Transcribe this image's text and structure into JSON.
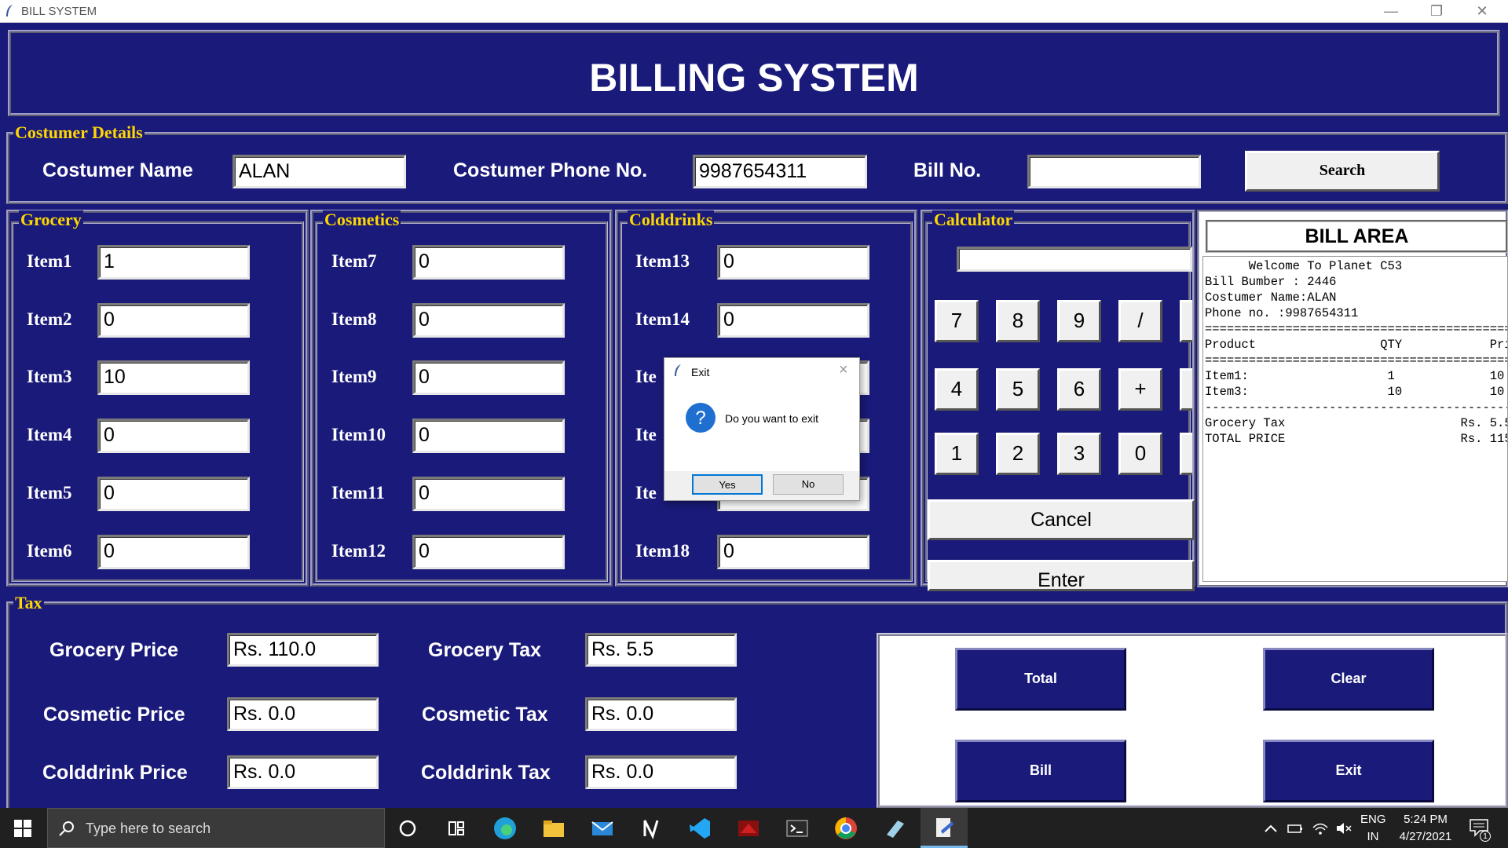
{
  "window": {
    "title": "BILL SYSTEM",
    "minimize": "—",
    "restore": "❐",
    "close": "✕"
  },
  "header": {
    "title": "BILLING SYSTEM"
  },
  "customer": {
    "section_label": "Costumer Details",
    "name_label": "Costumer Name",
    "name_value": "ALAN",
    "phone_label": "Costumer Phone No.",
    "phone_value": "9987654311",
    "bill_label": "Bill No.",
    "bill_value": "",
    "search_label": "Search"
  },
  "grocery": {
    "label": "Grocery",
    "items": [
      {
        "label": "Item1",
        "value": "1"
      },
      {
        "label": "Item2",
        "value": "0"
      },
      {
        "label": "Item3",
        "value": "10"
      },
      {
        "label": "Item4",
        "value": "0"
      },
      {
        "label": "Item5",
        "value": "0"
      },
      {
        "label": "Item6",
        "value": "0"
      }
    ]
  },
  "cosmetics": {
    "label": "Cosmetics",
    "items": [
      {
        "label": "Item7",
        "value": "0"
      },
      {
        "label": "Item8",
        "value": "0"
      },
      {
        "label": "Item9",
        "value": "0"
      },
      {
        "label": "Item10",
        "value": "0"
      },
      {
        "label": "Item11",
        "value": "0"
      },
      {
        "label": "Item12",
        "value": "0"
      }
    ]
  },
  "colddrinks": {
    "label": "Colddrinks",
    "items": [
      {
        "label": "Item13",
        "value": "0"
      },
      {
        "label": "Item14",
        "value": "0"
      },
      {
        "label": "Ite",
        "value": ""
      },
      {
        "label": "Ite",
        "value": ""
      },
      {
        "label": "Ite",
        "value": ""
      },
      {
        "label": "Item18",
        "value": "0"
      }
    ]
  },
  "calculator": {
    "label": "Calculator",
    "display": "",
    "rows": [
      [
        "7",
        "8",
        "9",
        "/"
      ],
      [
        "4",
        "5",
        "6",
        "+"
      ],
      [
        "1",
        "2",
        "3",
        "0"
      ]
    ],
    "cancel_label": "Cancel",
    "enter_label": "Enter"
  },
  "bill_area": {
    "title": "BILL AREA",
    "lines": [
      "      Welcome To Planet C53",
      "Bill Bumber : 2446",
      "Costumer Name:ALAN",
      "Phone no. :9987654311",
      "=================================================",
      "Product                 QTY            Pri",
      "=================================================",
      "Item1:                   1             10",
      "Item3:                   10            10",
      "-------------------------------------------------",
      "Grocery Tax                        Rs. 5.5",
      "TOTAL PRICE                        Rs. 115"
    ]
  },
  "tax": {
    "label": "Tax",
    "grocery_price_label": "Grocery Price",
    "grocery_price_value": "Rs. 110.0",
    "cosmetic_price_label": "Cosmetic Price",
    "cosmetic_price_value": "Rs. 0.0",
    "colddrink_price_label": "Colddrink Price",
    "colddrink_price_value": "Rs. 0.0",
    "grocery_tax_label": "Grocery Tax",
    "grocery_tax_value": "Rs. 5.5",
    "cosmetic_tax_label": "Cosmetic Tax",
    "cosmetic_tax_value": "Rs. 0.0",
    "colddrink_tax_label": "Colddrink Tax",
    "colddrink_tax_value": "Rs. 0.0"
  },
  "actions": {
    "total": "Total",
    "clear": "Clear",
    "bill": "Bill",
    "exit": "Exit"
  },
  "dialog": {
    "title": "Exit",
    "message": "Do you want to exit",
    "yes": "Yes",
    "no": "No",
    "close": "×"
  },
  "taskbar": {
    "search_placeholder": "Type here to search",
    "lang_top": "ENG",
    "lang_bottom": "IN",
    "time": "5:24 PM",
    "date": "4/27/2021",
    "notif_count": "1"
  }
}
